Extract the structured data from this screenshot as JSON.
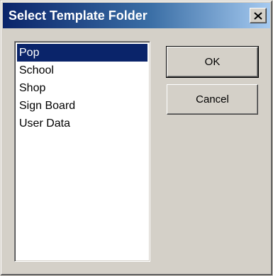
{
  "window": {
    "title": "Select Template Folder",
    "close_icon": "close-x-icon"
  },
  "folders": {
    "items": [
      {
        "label": "Pop",
        "selected": true
      },
      {
        "label": "School",
        "selected": false
      },
      {
        "label": "Shop",
        "selected": false
      },
      {
        "label": "Sign Board",
        "selected": false
      },
      {
        "label": "User Data",
        "selected": false
      }
    ]
  },
  "buttons": {
    "ok_label": "OK",
    "cancel_label": "Cancel"
  },
  "colors": {
    "face": "#d4d0c8",
    "selection": "#0a246a",
    "title_start": "#0a246a",
    "title_end": "#a6caf0"
  }
}
